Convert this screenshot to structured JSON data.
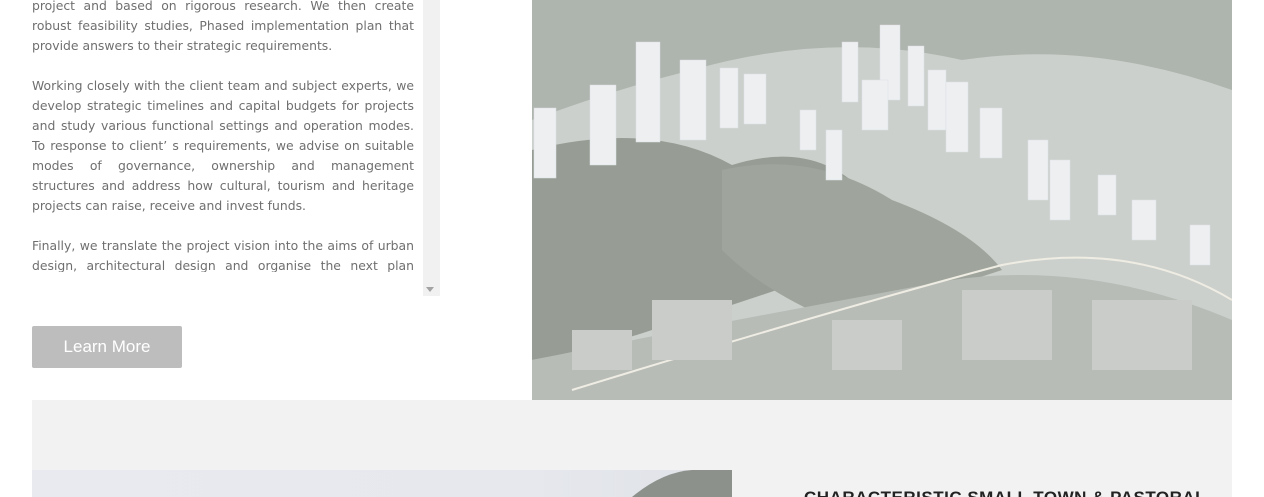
{
  "intro": {
    "paragraphs": [
      "project and based on rigorous research. We then create robust feasibility studies, Phased implementation plan that provide answers to their strategic requirements.",
      "Working closely with the client team and subject experts, we develop strategic timelines and capital budgets for projects and study various functional settings and operation modes. To response to client’ s requirements, we advise on suitable modes of governance, ownership and management structures and address how cultural, tourism and heritage projects can raise, receive and invest funds.",
      "Finally, we translate the project vision into the aims of urban design, architectural design and organise the next plan workflow."
    ]
  },
  "cta": {
    "label": "Learn More"
  },
  "next_section": {
    "heading": "CHARACTERISTIC SMALL TOWN & PASTORAL COMPLEX"
  },
  "colors": {
    "button_bg": "#bdbdbd",
    "band_bg": "#f2f2f2",
    "body_text": "#6f6f6f"
  }
}
